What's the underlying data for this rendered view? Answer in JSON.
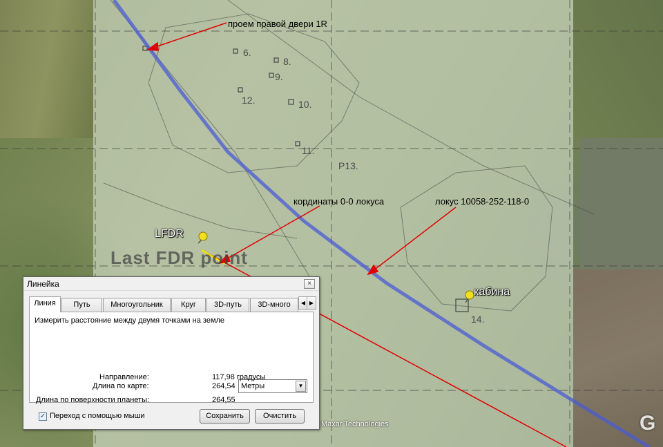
{
  "map": {
    "annotations": {
      "door_label": "проем правой двери 1R",
      "coords_label": "кординаты 0-0 локуса",
      "locus_label": "локус 10058-252-118-0"
    },
    "placemarks": {
      "lfdr": "LFDR",
      "cabin": "кабина"
    },
    "overlay_text": "Last FDR point",
    "plot_numbers": [
      "6.",
      "8.",
      "9.",
      "12.",
      "10.",
      "11.",
      "P13.",
      "14."
    ],
    "attribution": "Maxar Technologies",
    "logo": "G",
    "colors": {
      "flight_path": "#4a5bd6",
      "ruler_line": "#e00000",
      "arrow": "#e00000",
      "ruler_segment": "#f5e400",
      "pin": "#f0e020"
    }
  },
  "ruler": {
    "title": "Линейка",
    "close_icon": "×",
    "tabs": [
      {
        "label": "Линия",
        "active": true
      },
      {
        "label": "Путь",
        "active": false
      },
      {
        "label": "Многоугольник",
        "active": false
      },
      {
        "label": "Круг",
        "active": false
      },
      {
        "label": "3D-путь",
        "active": false
      },
      {
        "label": "3D-много",
        "active": false
      }
    ],
    "tab_scroll_left": "◀",
    "tab_scroll_right": "▶",
    "description": "Измерить расстояние между двумя точками на земле",
    "map_length_label": "Длина по карте:",
    "map_length_value": "264,54",
    "units_value": "Метры",
    "units_arrow": "▼",
    "surface_length_label": "Длина по поверхности планеты:",
    "surface_length_value": "264,55",
    "heading_label": "Направление:",
    "heading_value": "117,98 градусы",
    "mouse_nav_checked": true,
    "mouse_nav_check": "✓",
    "mouse_nav_label": "Переход с помощью мыши",
    "save_label": "Сохранить",
    "clear_label": "Очистить"
  }
}
